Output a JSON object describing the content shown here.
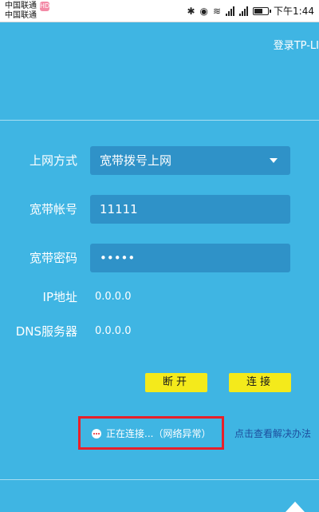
{
  "status_bar": {
    "carrier_1": "中国联通",
    "carrier_2": "中国联通",
    "carrier_badge": "HD",
    "network_label": "4G",
    "network_label_2": "2G",
    "time": "下午1:44"
  },
  "header": {
    "login_link": "登录TP-LI"
  },
  "form": {
    "connection_type": {
      "label": "上网方式",
      "value": "宽带拨号上网"
    },
    "account": {
      "label": "宽带帐号",
      "value": "11111"
    },
    "password": {
      "label": "宽带密码",
      "value": "•••••"
    },
    "ip": {
      "label": "IP地址",
      "value": "0.0.0.0"
    },
    "dns": {
      "label": "DNS服务器",
      "value": "0.0.0.0"
    }
  },
  "buttons": {
    "disconnect": "断开",
    "connect": "连接"
  },
  "status": {
    "text": "正在连接...（网络异常）",
    "help_link": "点击查看解决办法",
    "highlight_color": "#e8202a"
  },
  "colors": {
    "background": "#3fb5e3",
    "field": "#2f92c8",
    "button": "#f4ea1b",
    "link": "#1d4e9e"
  }
}
